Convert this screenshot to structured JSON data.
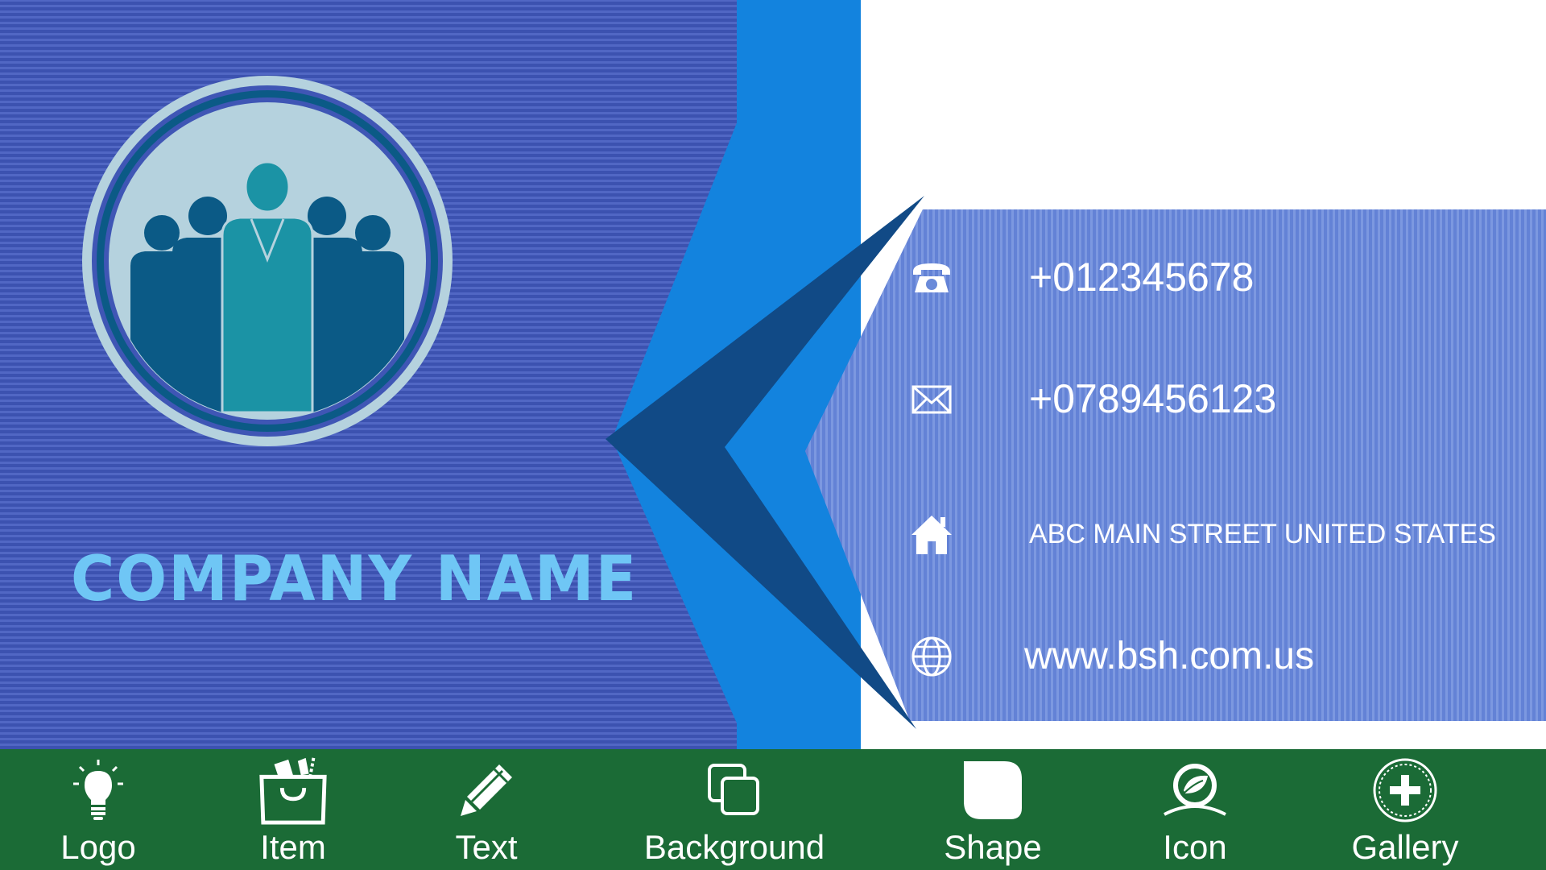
{
  "card": {
    "company_name": "COMPANY NAME",
    "contacts": [
      {
        "icon": "phone-icon",
        "text": "+012345678"
      },
      {
        "icon": "envelope-icon",
        "text": "+0789456123"
      },
      {
        "icon": "home-icon",
        "text": "ABC MAIN STREET UNITED STATES"
      },
      {
        "icon": "globe-icon",
        "text": "www.bsh.com.us"
      }
    ],
    "colors": {
      "left_panel": "#3f56b5",
      "blue_band": "#1383de",
      "chevron": "#114a86",
      "info_panel": "#6a8ad9",
      "company_name": "#6fc6f5",
      "logo_ring": "#b5d2de",
      "logo_figures_dark": "#0b5a86",
      "logo_figure_center": "#1b93a5"
    },
    "logo_icon": "team-people-logo"
  },
  "toolbar": {
    "background": "#1b6b36",
    "items": [
      {
        "label": "Logo",
        "icon": "lightbulb-icon"
      },
      {
        "label": "Item",
        "icon": "shopping-bag-icon"
      },
      {
        "label": "Text",
        "icon": "pencil-icon"
      },
      {
        "label": "Background",
        "icon": "layers-squares-icon"
      },
      {
        "label": "Shape",
        "icon": "rounded-square-icon"
      },
      {
        "label": "Icon",
        "icon": "leaf-badge-icon"
      },
      {
        "label": "Gallery",
        "icon": "plus-circle-icon"
      }
    ]
  }
}
